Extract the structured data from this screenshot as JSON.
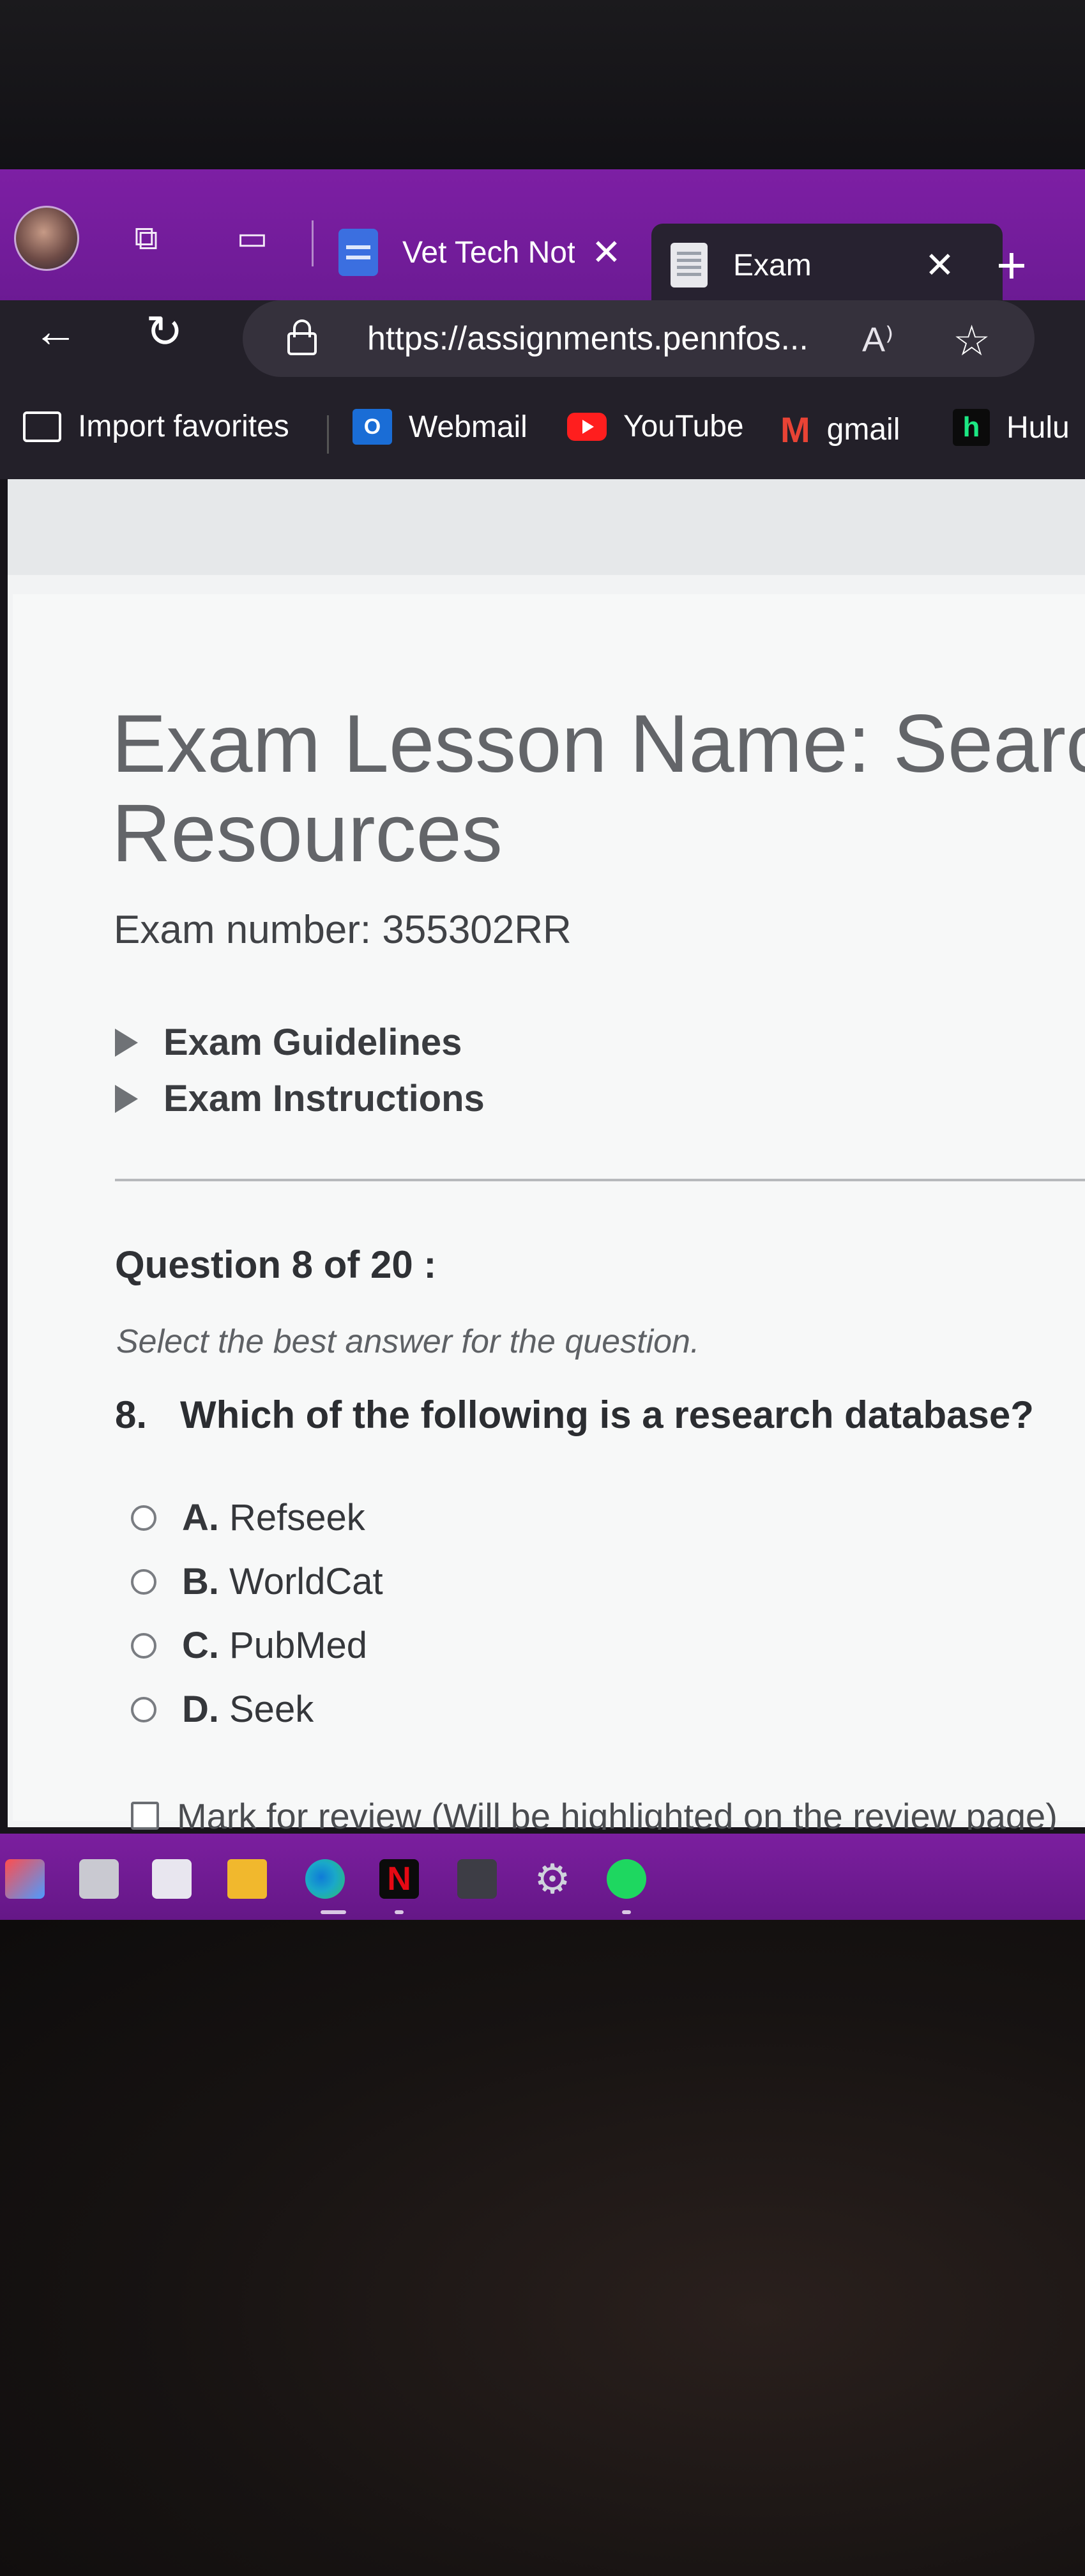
{
  "browser": {
    "tabs": [
      {
        "title": "Vet Tech Not",
        "close": "✕"
      },
      {
        "title": "Exam",
        "close": "✕"
      }
    ],
    "new_tab": "+",
    "nav": {
      "back": "←",
      "refresh": "↻"
    },
    "url": "https://assignments.pennfos...",
    "read_aloud": "A⁾",
    "favorite_star": "☆",
    "favorites": [
      {
        "label": "Import favorites"
      },
      {
        "label": "Webmail",
        "icon_text": "O"
      },
      {
        "label": "YouTube"
      },
      {
        "label": "gmail",
        "icon_text": "M"
      },
      {
        "label": "Hulu",
        "icon_text": "h"
      }
    ]
  },
  "exam": {
    "title_line1": "Exam Lesson Name: Searchin",
    "title_line2": "Resources",
    "number_text": "Exam number: 355302RR",
    "guidelines": "Exam Guidelines",
    "instructions": "Exam Instructions",
    "question_header": "Question 8 of 20 :",
    "instruction_text": "Select the best answer for the question.",
    "question_number": "8.",
    "question_text": "Which of the following is a research database?",
    "options": [
      {
        "letter": "A.",
        "text": "Refseek"
      },
      {
        "letter": "B.",
        "text": "WorldCat"
      },
      {
        "letter": "C.",
        "text": "PubMed"
      },
      {
        "letter": "D.",
        "text": "Seek"
      }
    ],
    "review_text": "Mark for review (Will be highlighted on the review page)"
  },
  "taskbar": {
    "netflix_label": "N",
    "settings_icon": "⚙"
  },
  "colors": {
    "tabstrip": "#7d1fa4",
    "toolbar": "#232029",
    "page_bg": "#f7f8f8",
    "title_text": "#636569"
  }
}
